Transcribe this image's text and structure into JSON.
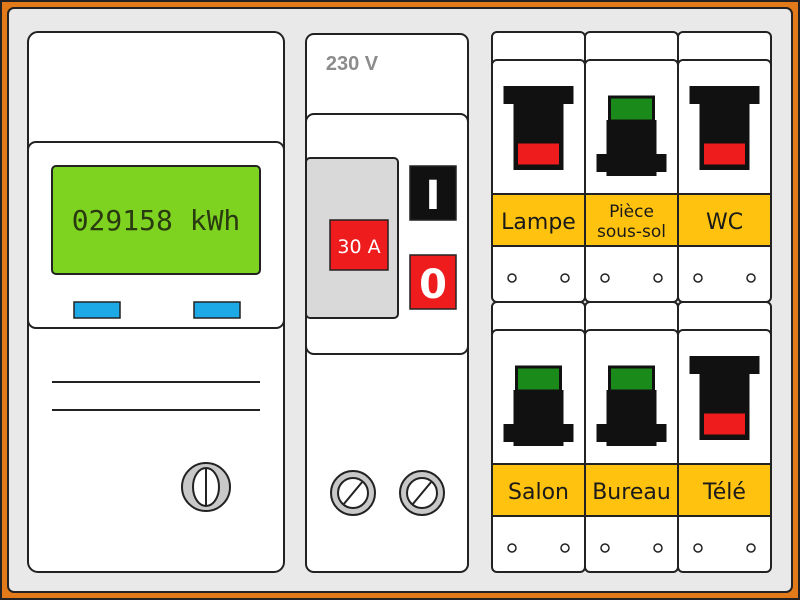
{
  "meter": {
    "reading": "029158 kWh"
  },
  "main_breaker": {
    "voltage": "230 V",
    "rating": "30 A",
    "on_label": "I",
    "off_label": "0"
  },
  "breakers": [
    {
      "label_lines": [
        "Lampe"
      ],
      "state": "off"
    },
    {
      "label_lines": [
        "Pièce",
        "sous-sol"
      ],
      "state": "on"
    },
    {
      "label_lines": [
        "WC"
      ],
      "state": "off"
    },
    {
      "label_lines": [
        "Salon"
      ],
      "state": "on"
    },
    {
      "label_lines": [
        "Bureau"
      ],
      "state": "on"
    },
    {
      "label_lines": [
        "Télé"
      ],
      "state": "off"
    }
  ],
  "colors": {
    "frame": "#e27a1a",
    "panel": "#e9e9e9",
    "lcd": "#7ed321",
    "label_band": "#ffc20e",
    "on_indicator": "#1a8a1a",
    "off_indicator": "#ee1c1c",
    "meter_button": "#1ca9e6"
  }
}
